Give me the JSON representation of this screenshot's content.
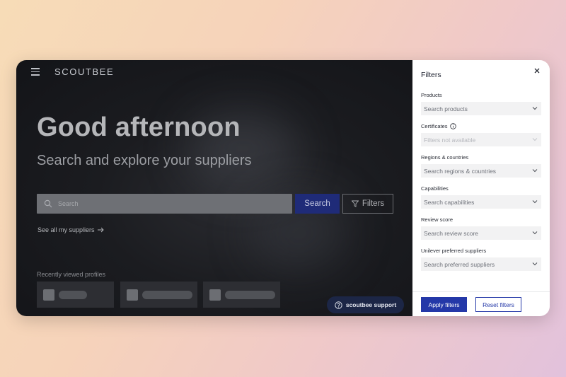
{
  "app": {
    "logo": "SCOUTBEE"
  },
  "hero": {
    "greeting": "Good afternoon",
    "subtitle": "Search and explore your suppliers"
  },
  "search": {
    "placeholder": "Search",
    "button_label": "Search",
    "filters_label": "Filters"
  },
  "links": {
    "see_all": "See all my suppliers"
  },
  "recent": {
    "label": "Recently viewed profiles",
    "cards": 3
  },
  "support": {
    "label": "scoutbee support"
  },
  "filters_panel": {
    "title": "Filters",
    "fields": [
      {
        "label": "Products",
        "placeholder": "Search products",
        "disabled": false,
        "info": false
      },
      {
        "label": "Certificates",
        "placeholder": "Filters not available",
        "disabled": true,
        "info": true
      },
      {
        "label": "Regions & countries",
        "placeholder": "Search regions & countries",
        "disabled": false,
        "info": false
      },
      {
        "label": "Capabilities",
        "placeholder": "Search capabilities",
        "disabled": false,
        "info": false
      },
      {
        "label": "Review score",
        "placeholder": "Search review score",
        "disabled": false,
        "info": false
      },
      {
        "label": "Unilever preferred suppliers",
        "placeholder": "Search preferred suppliers",
        "disabled": false,
        "info": false
      }
    ],
    "apply_label": "Apply filters",
    "reset_label": "Reset filters"
  },
  "colors": {
    "primary": "#2438a8",
    "search_button": "#1f2b78",
    "support_button": "#1c2646",
    "background_dark": "#131418"
  }
}
